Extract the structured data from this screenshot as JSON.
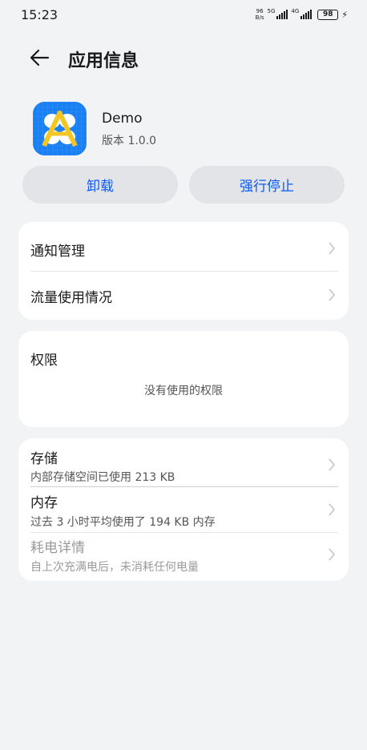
{
  "status_bar": {
    "time": "15:23",
    "speed_value": "96",
    "speed_unit": "B/s",
    "net_1": "5G",
    "net_2": "4G",
    "battery": "98"
  },
  "header": {
    "title": "应用信息",
    "back_icon": "arrow-left-icon"
  },
  "app": {
    "name": "Demo",
    "version": "版本 1.0.0",
    "icon_color": "#1a7ff0"
  },
  "actions": {
    "uninstall": "卸载",
    "force_stop": "强行停止"
  },
  "settings": {
    "notification": "通知管理",
    "data_usage": "流量使用情况"
  },
  "permissions": {
    "title": "权限",
    "empty": "没有使用的权限"
  },
  "storage_card": {
    "storage_title": "存储",
    "storage_sub": "内部存储空间已使用 213 KB",
    "memory_title": "内存",
    "memory_sub": "过去 3 小时平均使用了 194 KB 内存",
    "power_title": "耗电详情",
    "power_sub": "自上次充满电后，未消耗任何电量"
  },
  "colors": {
    "accent": "#0a59f7",
    "background": "#f1f3f5"
  }
}
